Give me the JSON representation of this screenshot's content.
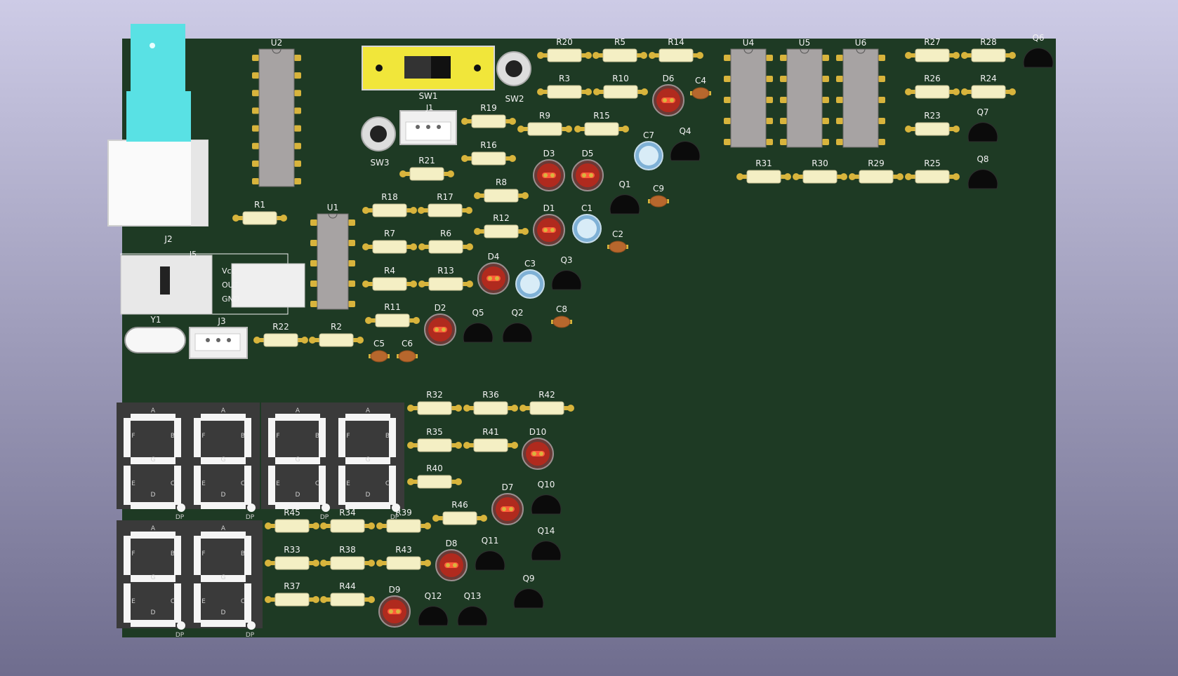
{
  "colors": {
    "background_top": "#cdcbe6",
    "background_bottom": "#6f6d8e",
    "pcb": "#1e3a24",
    "silkscreen": "#f2f2f2",
    "resistor_body": "#f4efc4",
    "pad_gold": "#d8b43c",
    "ic_body": "#a7a3a3",
    "led": "#b02a1e",
    "transistor": "#0b0b0b",
    "ceramic_cap": "#b7672d",
    "electrolytic_cap": "#d8ecf7",
    "switch_yellow": "#f1e63a",
    "pot_cyan": "#59e1e4",
    "seg_display": "#3a3a3a"
  },
  "components": {
    "resistors": [
      "R1",
      "R2",
      "R3",
      "R4",
      "R5",
      "R6",
      "R7",
      "R8",
      "R9",
      "R10",
      "R11",
      "R12",
      "R13",
      "R14",
      "R15",
      "R16",
      "R17",
      "R18",
      "R19",
      "R20",
      "R21",
      "R22",
      "R23",
      "R24",
      "R25",
      "R26",
      "R27",
      "R28",
      "R29",
      "R30",
      "R31",
      "R32",
      "R33",
      "R34",
      "R35",
      "R36",
      "R37",
      "R38",
      "R39",
      "R40",
      "R41",
      "R42",
      "R43",
      "R44",
      "R45",
      "R46"
    ],
    "ics": [
      "U1",
      "U2",
      "U4",
      "U5",
      "U6"
    ],
    "leds": [
      "D1",
      "D2",
      "D3",
      "D4",
      "D5",
      "D6",
      "D7",
      "D8",
      "D9",
      "D10"
    ],
    "transistors": [
      "Q1",
      "Q2",
      "Q3",
      "Q4",
      "Q5",
      "Q6",
      "Q7",
      "Q8",
      "Q9",
      "Q10",
      "Q11",
      "Q12",
      "Q13",
      "Q14"
    ],
    "ceramic_caps": [
      "C2",
      "C4",
      "C5",
      "C6",
      "C8",
      "C9"
    ],
    "electrolytic_caps": [
      "C1",
      "C3",
      "C7"
    ],
    "switches": [
      "SW1",
      "SW2",
      "SW3"
    ],
    "connectors": [
      "J1",
      "J2",
      "J3",
      "J5"
    ],
    "crystal": "Y1",
    "j5_pins": [
      "Vcc",
      "OUT",
      "GND"
    ],
    "segment_letters": [
      "A",
      "B",
      "C",
      "D",
      "E",
      "F",
      "G",
      "DP"
    ]
  }
}
